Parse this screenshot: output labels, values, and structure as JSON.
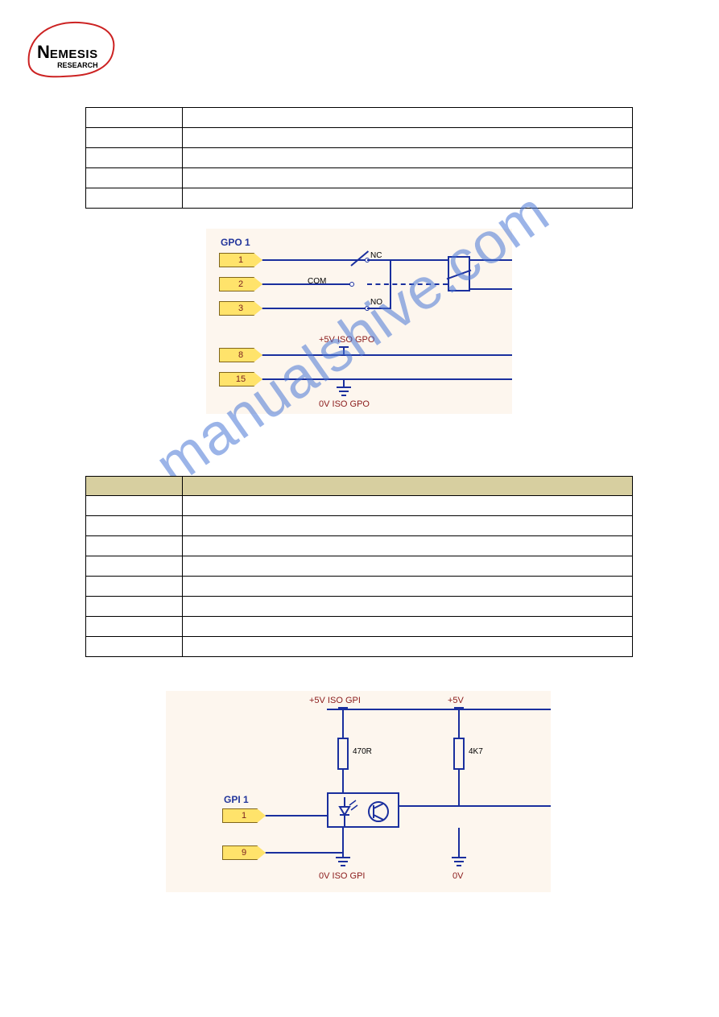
{
  "logo": {
    "brand_top": "N",
    "brand_rest": "EMESIS",
    "brand_sub": "RESEARCH"
  },
  "watermark": "manualshive.com",
  "table1": {
    "rows": [
      {
        "c1": "",
        "c2": ""
      },
      {
        "c1": "",
        "c2": ""
      },
      {
        "c1": "",
        "c2": ""
      },
      {
        "c1": "",
        "c2": ""
      },
      {
        "c1": "",
        "c2": ""
      }
    ]
  },
  "diagram1": {
    "title": "GPO 1",
    "pins": {
      "p1": "1",
      "p2": "2",
      "p3": "3",
      "p8": "8",
      "p15": "15"
    },
    "labels": {
      "nc": "NC",
      "com": "COM",
      "no": "NO",
      "rail5v": "+5V ISO GPO",
      "rail0v": "0V ISO GPO"
    }
  },
  "table2": {
    "header": {
      "c1": "",
      "c2": ""
    },
    "rows": [
      {
        "c1": "",
        "c2": ""
      },
      {
        "c1": "",
        "c2": ""
      },
      {
        "c1": "",
        "c2": ""
      },
      {
        "c1": "",
        "c2": ""
      },
      {
        "c1": "",
        "c2": ""
      },
      {
        "c1": "",
        "c2": ""
      },
      {
        "c1": "",
        "c2": ""
      },
      {
        "c1": "",
        "c2": ""
      }
    ]
  },
  "diagram2": {
    "title": "GPI 1",
    "pins": {
      "p1": "1",
      "p9": "9"
    },
    "labels": {
      "rail5v_iso": "+5V ISO GPI",
      "rail5v": "+5V",
      "r1": "470R",
      "r2": "4K7",
      "rail0v_iso": "0V ISO GPI",
      "rail0v": "0V"
    }
  }
}
